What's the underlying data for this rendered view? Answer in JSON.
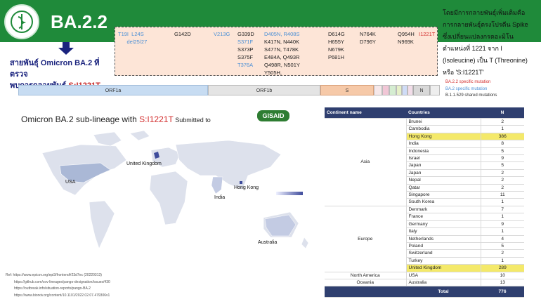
{
  "header": {
    "title": "BA.2.2",
    "colors": {
      "brand_green": "#1f8a3a",
      "accent_red": "#d32f2f",
      "accent_blue": "#4a8fd6",
      "table_header": "#2f3f6f",
      "highlight": "#f4e96a"
    }
  },
  "lineage_note": {
    "line1": "สายพันธุ์ Omicron BA.2 ที่ตรวจ",
    "line2_prefix": "พบการกลายพันธุ์ ",
    "line2_mut": "S:I1221T"
  },
  "mutations": {
    "col1": "T19I  L24S\n      del25/27",
    "col2": "G142D",
    "col3": "V213G",
    "col4": "G339D\nS371F\nS373P\nS375F\nT376A",
    "col4_blue": [
      false,
      true,
      false,
      false,
      true
    ],
    "col5_blue": "D405N, R408S",
    "col5_black": "K417N, N440K\nS477N, T478K\nE484A, Q493R\nQ498R, N501Y\nY505H,",
    "col6": "D614G\nH655Y\nN679K\nP681H",
    "col7": "N764K\nD796Y",
    "col8": "Q954H\nN969K",
    "col9_red": "I1221T"
  },
  "right_text": {
    "lines": [
      "โดยมีการกลายพันธุ์เพิ่มเติมคือ",
      "การกลายพันธุ์ตรงโปรตีน Spike",
      "ซึ่งเปลี่ยนแปลงกรดอะมิโน",
      "ตำแหน่งที่ 1221 จาก I",
      "(Isoleucine) เป็น T (Threonine)",
      "หรือ 'S:I1221T'"
    ],
    "legend": [
      "BA.2.2 specific mutation",
      "BA.2 specific mutation",
      "B.1.1.529 shared mutations"
    ]
  },
  "genome": [
    "ORF1a",
    "ORF1b",
    "S",
    "N"
  ],
  "subtitle": {
    "prefix": "Omicron BA.2 sub-lineage with ",
    "mut": "S:I1221T",
    "suffix": " Submitted to",
    "gisaid": "GISAID"
  },
  "map_labels": [
    "USA",
    "United Kingdom",
    "Hong Kong",
    "India",
    "Australia"
  ],
  "references": [
    "Ref: https://www.epicov.org/epi3/frontend#23d7ec (20220313)",
    "https://github.com/cov-lineages/pango-designation/issues/430",
    "https://outbreak.info/situation-reports/pango-BA.2",
    "https://www.biorxiv.org/content/10.1101/2022.02.07.479306v1"
  ],
  "table": {
    "headers": [
      "Continent name",
      "Countries",
      "N"
    ],
    "groups": [
      {
        "continent": "Asia",
        "rows": [
          {
            "country": "Brunei",
            "n": "2"
          },
          {
            "country": "Cambodia",
            "n": "1"
          },
          {
            "country": "Hong Kong",
            "n": "386",
            "hl": true
          },
          {
            "country": "India",
            "n": "8"
          },
          {
            "country": "Indonesia",
            "n": "5"
          },
          {
            "country": "Israel",
            "n": "9"
          },
          {
            "country": "Japan",
            "n": "5"
          },
          {
            "country": "Japan",
            "n": "2"
          },
          {
            "country": "Nepal",
            "n": "2"
          },
          {
            "country": "Qatar",
            "n": "2"
          },
          {
            "country": "Singapore",
            "n": "11"
          },
          {
            "country": "South Korea",
            "n": "1"
          }
        ]
      },
      {
        "continent": "Europe",
        "rows": [
          {
            "country": "Denmark",
            "n": "7"
          },
          {
            "country": "France",
            "n": "1"
          },
          {
            "country": "Germany",
            "n": "9"
          },
          {
            "country": "Italy",
            "n": "1"
          },
          {
            "country": "Netherlands",
            "n": "4"
          },
          {
            "country": "Poland",
            "n": "5"
          },
          {
            "country": "Switzerland",
            "n": "2"
          },
          {
            "country": "Turkey",
            "n": "1"
          },
          {
            "country": "United Kingdom",
            "n": "289",
            "hl": true
          }
        ]
      },
      {
        "continent": "North America",
        "rows": [
          {
            "country": "USA",
            "n": "10"
          }
        ]
      },
      {
        "continent": "Oceania",
        "rows": [
          {
            "country": "Australia",
            "n": "13"
          }
        ]
      }
    ],
    "total_label": "Total",
    "total": "776"
  }
}
